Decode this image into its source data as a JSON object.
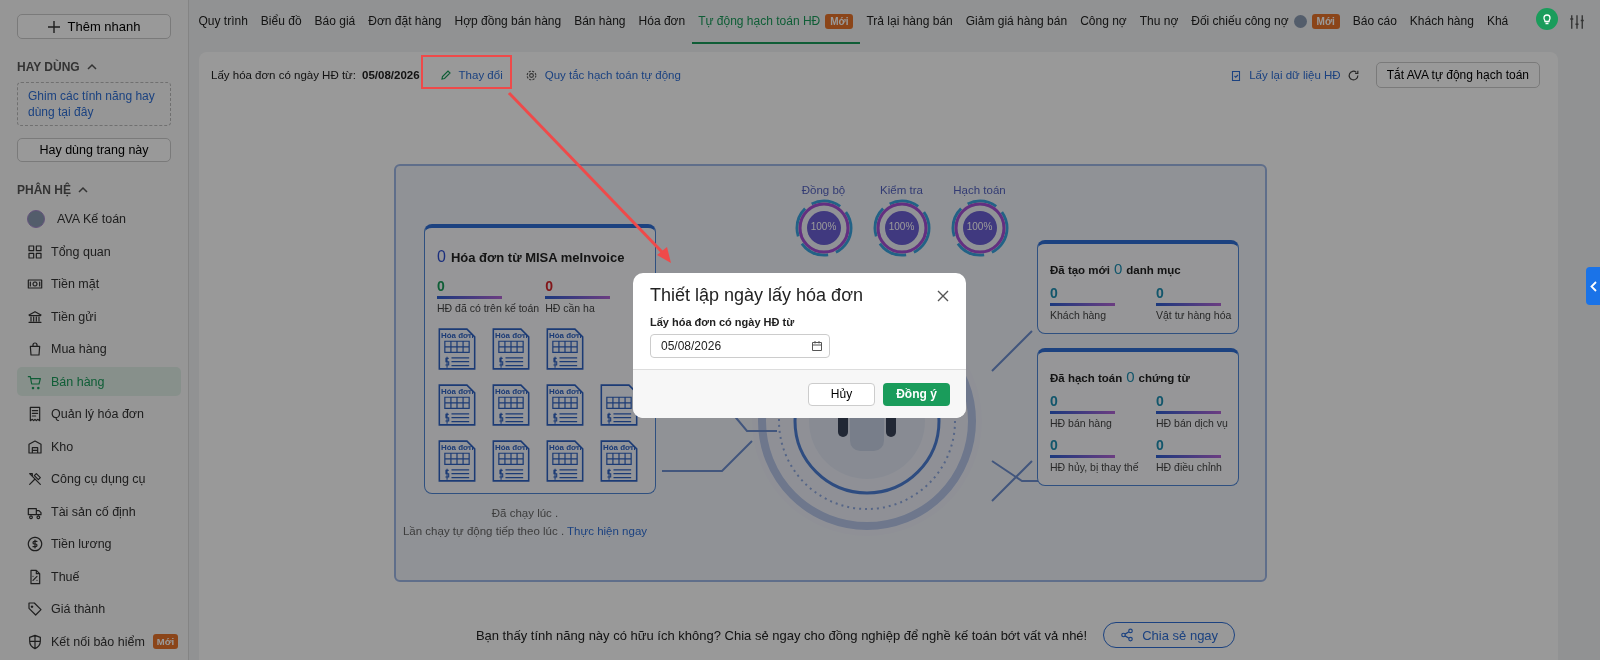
{
  "sidebar": {
    "quick_add": "Thêm nhanh",
    "favorites": {
      "title": "HAY DÙNG",
      "expanded": true,
      "pin_hint": "Ghim các tính năng hay dùng tại đây",
      "button": "Hay dùng trang này"
    },
    "modules": {
      "title": "PHÂN HỆ",
      "expanded": true,
      "items": [
        {
          "label": "AVA Kế toán",
          "selected": false
        },
        {
          "label": "Tổng quan",
          "selected": false
        },
        {
          "label": "Tiền mặt",
          "selected": false
        },
        {
          "label": "Tiền gửi",
          "selected": false
        },
        {
          "label": "Mua hàng",
          "selected": false
        },
        {
          "label": "Bán hàng",
          "selected": true
        },
        {
          "label": "Quản lý hóa đơn",
          "selected": false
        },
        {
          "label": "Kho",
          "selected": false
        },
        {
          "label": "Công cụ dụng cụ",
          "selected": false
        },
        {
          "label": "Tài sản cố định",
          "selected": false
        },
        {
          "label": "Tiền lương",
          "selected": false
        },
        {
          "label": "Thuế",
          "selected": false
        },
        {
          "label": "Giá thành",
          "selected": false
        },
        {
          "label": "Kết nối bảo hiểm",
          "selected": false,
          "badge": "Mới"
        }
      ]
    }
  },
  "tabs": [
    {
      "label": "Quy trình",
      "selected": false
    },
    {
      "label": "Biểu đồ",
      "selected": false
    },
    {
      "label": "Báo giá",
      "selected": false
    },
    {
      "label": "Đơn đặt hàng",
      "selected": false
    },
    {
      "label": "Hợp đồng bán hàng",
      "selected": false
    },
    {
      "label": "Bán hàng",
      "selected": false
    },
    {
      "label": "Hóa đơn",
      "selected": false
    },
    {
      "label": "Tự động hạch toán HĐ",
      "selected": true,
      "badge": "Mới"
    },
    {
      "label": "Trả lại hàng bán",
      "selected": false
    },
    {
      "label": "Giảm giá hàng bán",
      "selected": false
    },
    {
      "label": "Công nợ",
      "selected": false
    },
    {
      "label": "Thu nợ",
      "selected": false
    },
    {
      "label": "Đối chiếu công nợ",
      "selected": false,
      "avatar": true,
      "badge": "Mới"
    },
    {
      "label": "Báo cáo",
      "selected": false
    },
    {
      "label": "Khách hàng",
      "selected": false
    },
    {
      "label": "Khá",
      "selected": false
    }
  ],
  "toolbar": {
    "date_label": "Lấy hóa đơn có ngày HĐ từ:",
    "date": "05/08/2026",
    "change_link": "Thay đổi",
    "rules_link": "Quy tắc hạch toán tự động",
    "reload_link": "Lấy lại dữ liệu HĐ",
    "toggle_button": "Tắt AVA tự động hạch toán"
  },
  "dashboard": {
    "stages": [
      {
        "label": "Đồng bộ",
        "reading": "100%",
        "level": 1
      },
      {
        "label": "Kiểm tra",
        "reading": "100%",
        "level": 1
      },
      {
        "label": "Hạch toán",
        "reading": "100%",
        "level": 1
      }
    ],
    "invoices": {
      "count": "0",
      "title": "Hóa đơn từ MISA meInvoice",
      "stats": [
        {
          "value": "0",
          "label": "HĐ đã có trên kế toán",
          "kind": "ok"
        },
        {
          "value": "0",
          "label": "HĐ cần ha",
          "kind": "alert"
        }
      ],
      "docs": [
        {
          "label": "Hóa đơn"
        },
        {
          "label": "Hóa đơn"
        },
        {
          "label": "Hóa đơn"
        },
        {
          "kind": "covered"
        },
        {
          "label": "Hóa đơn"
        },
        {
          "label": "Hóa đơn"
        },
        {
          "label": "Hóa đơn"
        },
        {
          "kind": "partial"
        },
        {
          "label": "Hóa đơn"
        },
        {
          "label": "Hóa đơn"
        },
        {
          "label": "Hóa đơn"
        },
        {
          "label": "Hóa đơn"
        }
      ]
    },
    "last_run": "Đã chạy lúc .",
    "next_run": "Lần chạy tự động tiếp theo lúc .",
    "run_now": "Thực hiện ngay",
    "cards": [
      {
        "prefix": "Đã tạo mới",
        "count": "0",
        "suffix": "danh mục",
        "stats": [
          {
            "value": "0",
            "label": "Khách hàng"
          },
          {
            "value": "0",
            "label": "Vật tư hàng hóa"
          }
        ]
      },
      {
        "prefix": "Đã hạch toán",
        "count": "0",
        "suffix": "chứng từ",
        "stats": [
          {
            "value": "0",
            "label": "HĐ bán hàng"
          },
          {
            "value": "0",
            "label": "HĐ bán dịch vụ"
          },
          {
            "value": "0",
            "label": "HĐ hủy, bị thay thế"
          },
          {
            "value": "0",
            "label": "HĐ điều chỉnh"
          }
        ]
      }
    ]
  },
  "share": {
    "text": "Bạn thấy tính năng này có hữu ích không? Chia sẻ ngay cho đồng nghiệp để nghề kế toán bớt vất vả nhé!",
    "button": "Chia sẻ ngay"
  },
  "dialog": {
    "title": "Thiết lập ngày lấy hóa đơn",
    "field_label": "Lấy hóa đơn có ngày HĐ từ",
    "value": "05/08/2026",
    "cancel": "Hủy",
    "confirm": "Đồng ý"
  }
}
